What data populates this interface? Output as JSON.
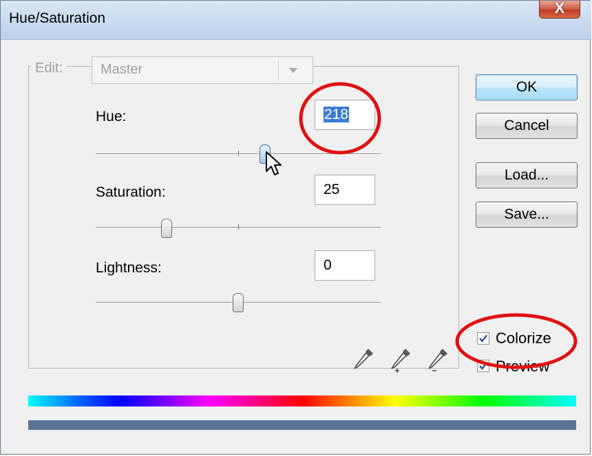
{
  "window": {
    "title": "Hue/Saturation",
    "close_glyph": "X"
  },
  "edit": {
    "label": "Edit:",
    "value": "Master"
  },
  "sliders": {
    "hue": {
      "label": "Hue:",
      "value": "218",
      "position": 0.61
    },
    "saturation": {
      "label": "Saturation:",
      "value": "25",
      "position": 0.25
    },
    "lightness": {
      "label": "Lightness:",
      "value": "0",
      "position": 0.5
    }
  },
  "buttons": {
    "ok": "OK",
    "cancel": "Cancel",
    "load": "Load...",
    "save": "Save..."
  },
  "options": {
    "colorize": {
      "label": "Colorize",
      "checked": true
    },
    "preview": {
      "label": "Preview",
      "checked": true
    }
  },
  "tools": [
    "eyedropper-icon",
    "eyedropper-plus-icon",
    "eyedropper-minus-icon"
  ],
  "colors": {
    "result_bar": "#5a7497",
    "annotation": "#e01010",
    "selection": "#3a7bd6"
  }
}
